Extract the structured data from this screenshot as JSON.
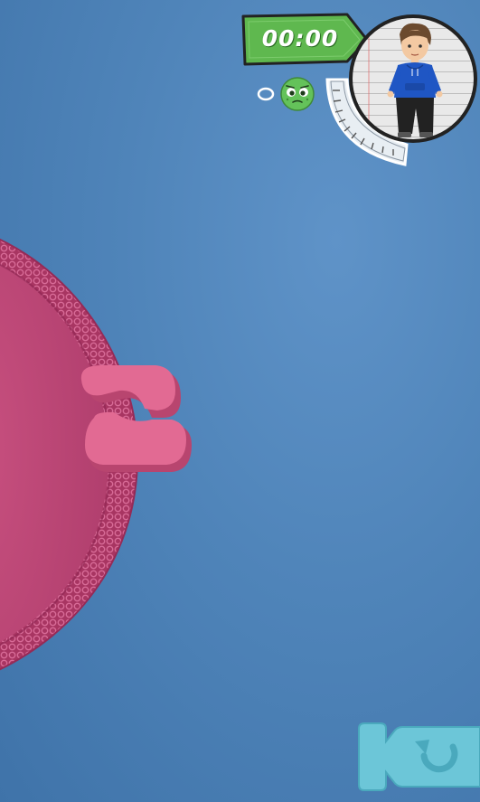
{
  "hud": {
    "timer": "00:00",
    "timer_color": "#5fb84f",
    "player_icon": "boy-avatar-icon",
    "mood_icon": "green-worried-face-icon",
    "gauge_icon": "measuring-gauge-icon"
  },
  "scene": {
    "background_color": "#4f84b9",
    "cell_color": "#c24a78",
    "fragment_color": "#e06090"
  },
  "controls": {
    "replay_icon": "camera-replay-icon",
    "replay_color": "#6cc6d8"
  }
}
